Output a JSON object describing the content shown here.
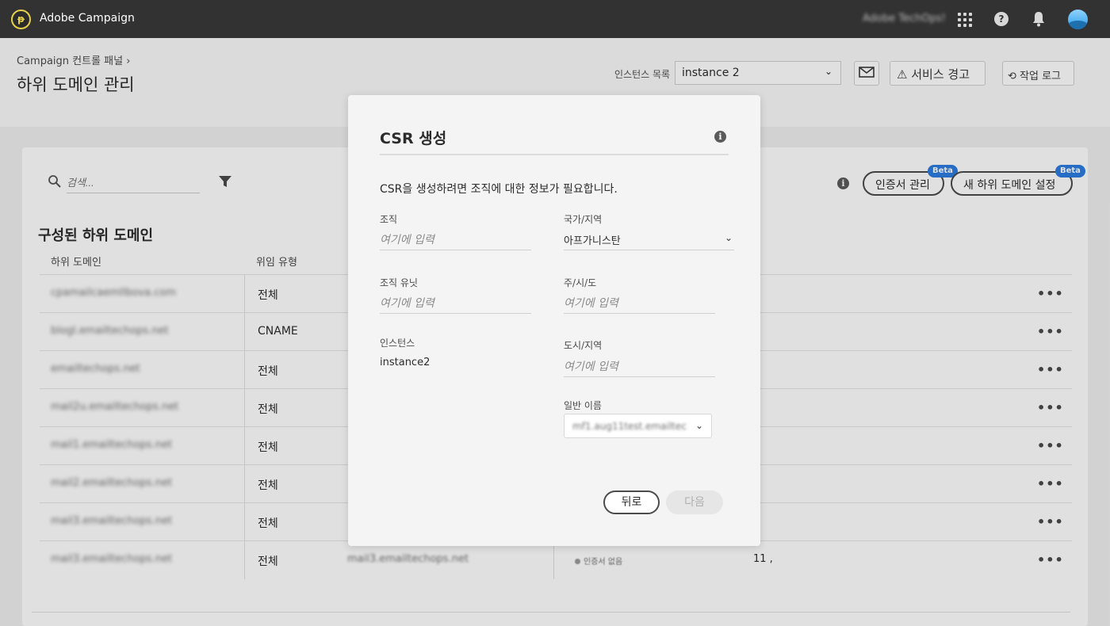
{
  "topbar": {
    "app_title": "Adobe Campaign",
    "org_name": "Adobe TechOps!",
    "icons": [
      "adobe-campaign-logo",
      "app-switcher-grid-icon",
      "help-icon",
      "bell-icon",
      "avatar"
    ]
  },
  "header": {
    "breadcrumb": "Campaign 컨트롤 패널",
    "breadcrumb_chevron": "›",
    "title": "하위 도메인 관리",
    "instance_label": "인스턴스 목록",
    "instance_value": "instance 2",
    "service_alerts_label": "서비스 경고",
    "job_log_label": "작업 로그"
  },
  "toolbar": {
    "search_placeholder": "검색...",
    "manage_certs_label": "인증서 관리",
    "new_subdomain_label": "새 하위 도메인 설정",
    "beta_label": "Beta"
  },
  "table": {
    "section_title": "구성된 하위 도메인",
    "columns": [
      "하위 도메인",
      "위임 유형"
    ],
    "rows": [
      {
        "domain": "cpamailcaemllbova.com",
        "type": "전체"
      },
      {
        "domain": "blogl.emailtechops.net",
        "type": "CNAME"
      },
      {
        "domain": "emailtechops.net",
        "type": "전체"
      },
      {
        "domain": "mail2u.emailtechops.net",
        "type": "전체"
      },
      {
        "domain": "mail1.emailtechops.net",
        "type": "전체"
      },
      {
        "domain": "mail2.emailtechops.net",
        "type": "전체"
      },
      {
        "domain": "mail3.emailtechops.net",
        "type": "전체"
      },
      {
        "domain": "mail3.emailtechops.net",
        "type": "전체",
        "subdomain": "mail3.emailtechops.net",
        "status": "인증서 없음",
        "count": "11 ,"
      }
    ],
    "more_label": "•••"
  },
  "modal": {
    "title": "CSR 생성",
    "description": "CSR을 생성하려면 조직에 대한 정보가 필요합니다.",
    "fields": {
      "organization_label": "조직",
      "organization_placeholder": "여기에 입력",
      "country_label": "국가/지역",
      "country_value": "아프가니스탄",
      "org_unit_label": "조직 유닛",
      "org_unit_placeholder": "여기에 입력",
      "state_label": "주/시/도",
      "state_placeholder": "여기에 입력",
      "instance_label": "인스턴스",
      "instance_value": "instance2",
      "city_label": "도시/지역",
      "city_placeholder": "여기에 입력",
      "common_name_label": "일반 이름",
      "common_name_value": "mf1.aug11test.emailtech..."
    },
    "back_label": "뒤로",
    "next_label": "다음"
  }
}
